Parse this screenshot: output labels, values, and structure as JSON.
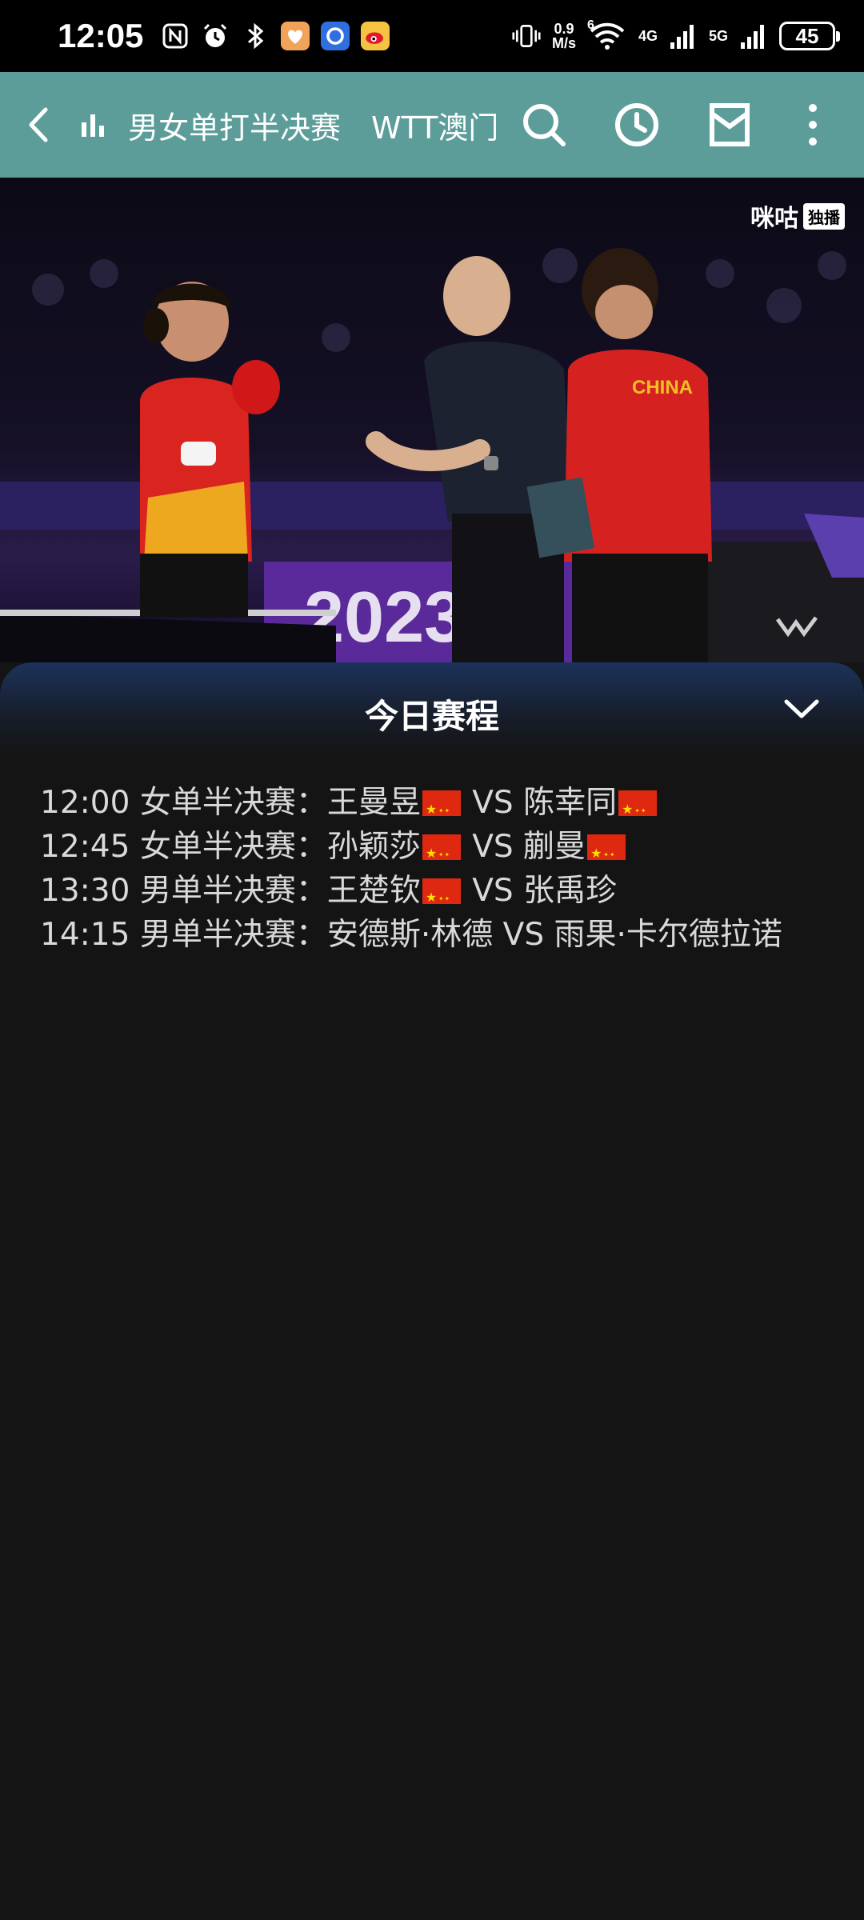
{
  "status_bar": {
    "time": "12:05",
    "network_speed_value": "0.9",
    "network_speed_unit": "M/s",
    "wifi_badge": "6",
    "sim1_label": "4G",
    "sim2_label": "5G",
    "battery": "45"
  },
  "header": {
    "title": "男女单打半决赛　WTT澳门冠军赛",
    "icons": [
      "back-arrow-icon",
      "bar-chart-icon",
      "search-icon",
      "history-clock-icon",
      "inbox-icon",
      "more-vert-icon"
    ]
  },
  "video": {
    "watermark": "咪咕",
    "watermark_badge": "独播"
  },
  "schedule": {
    "title": "今日赛程",
    "items": [
      {
        "time": "12:00",
        "event": "女单半决赛：",
        "p1": "王曼昱",
        "p1_flag": true,
        "vs": "VS",
        "p2": "陈幸同",
        "p2_flag": true
      },
      {
        "time": "12:45",
        "event": "女单半决赛：",
        "p1": "孙颖莎",
        "p1_flag": true,
        "vs": "VS",
        "p2": "蒯曼",
        "p2_flag": true
      },
      {
        "time": "13:30",
        "event": "男单半决赛：",
        "p1": "王楚钦",
        "p1_flag": true,
        "vs": "VS",
        "p2": "张禹珍",
        "p2_flag": false
      },
      {
        "time": "14:15",
        "event": "男单半决赛：",
        "p1": "安德斯·林德",
        "p1_flag": false,
        "vs": "VS",
        "p2": "雨果·卡尔德拉诺",
        "p2_flag": false
      }
    ]
  },
  "colors": {
    "header_bg": "#5c9d9a",
    "sheet_bg": "#141414",
    "flag_red": "#de2910",
    "flag_yellow": "#ffde00"
  }
}
